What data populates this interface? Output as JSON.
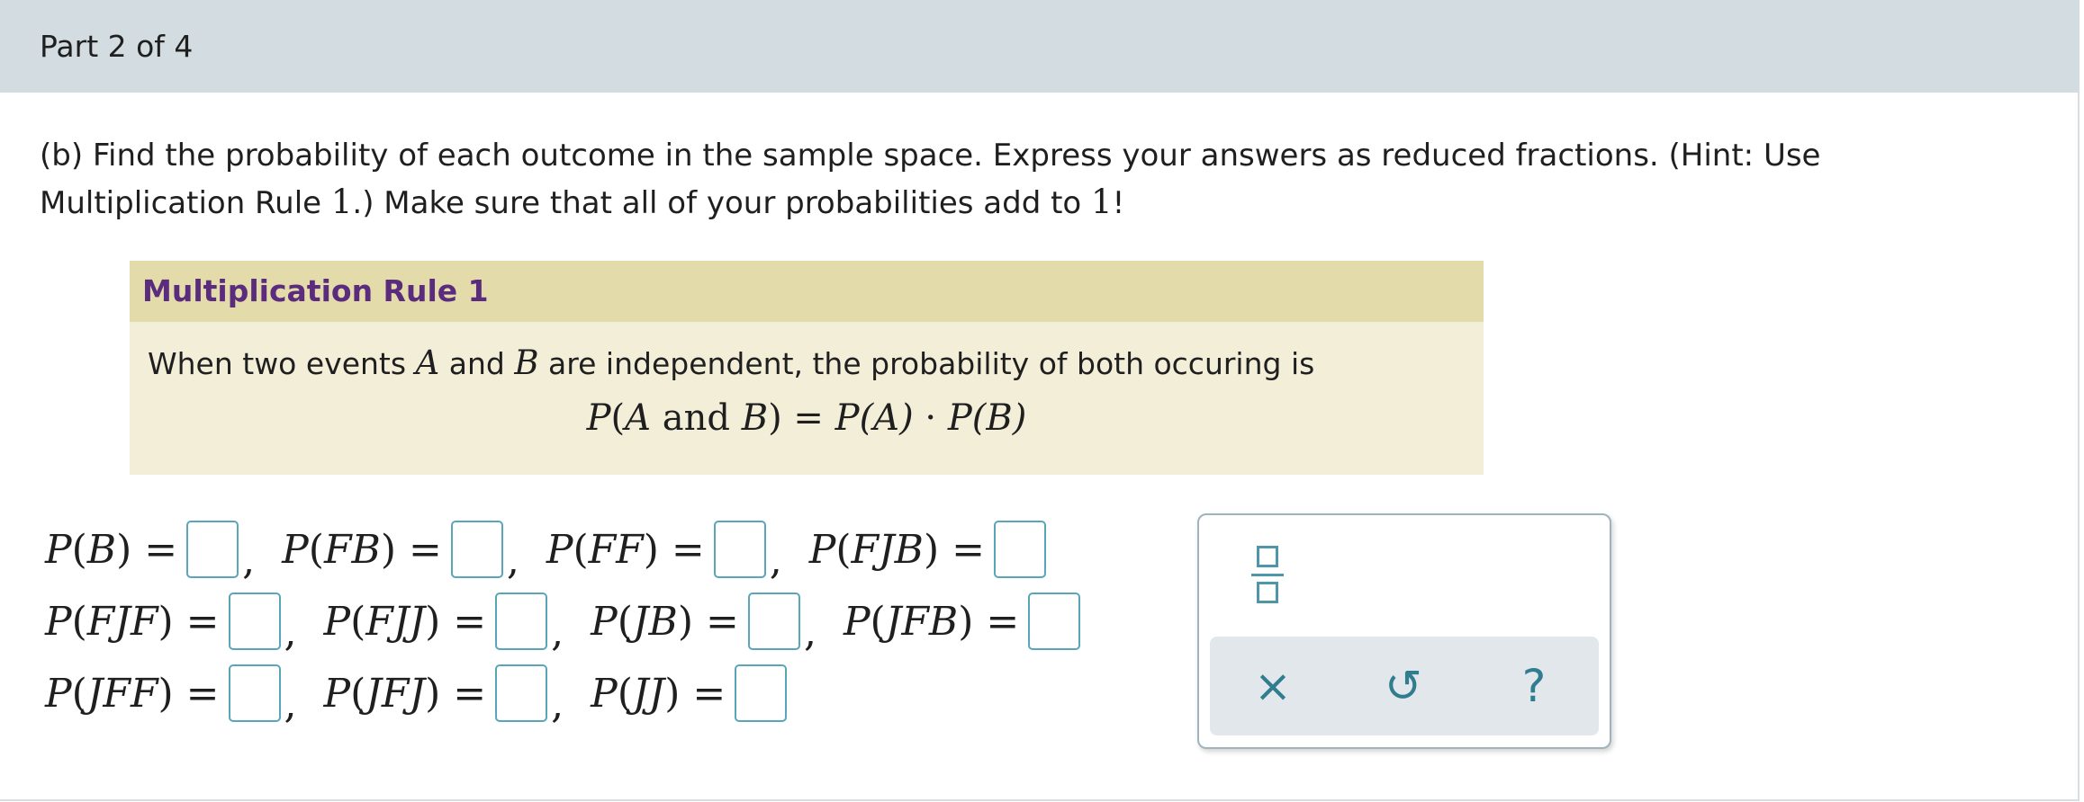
{
  "header": {
    "part_label": "Part 2 of 4"
  },
  "question": {
    "text_before_1": "(b) Find the probability of each outcome in the sample space. Express your answers as reduced fractions. (Hint: Use Multiplication Rule ",
    "one_a": "1",
    "text_middle": ".) Make sure that all of your probabilities add to ",
    "one_b": "1",
    "text_end": "!"
  },
  "rule_box": {
    "title": "Multiplication Rule 1",
    "text_before": "When two events ",
    "var_a": "A",
    "text_and": " and ",
    "var_b": "B",
    "text_after": " are independent, the probability of both occuring is",
    "formula": {
      "p1": "P",
      "open1": "(",
      "a1": "A",
      "and": " and ",
      "b1": "B",
      "close_eq": ") = ",
      "p2": "P",
      "a2": "(A)",
      "dot": " · ",
      "p3": "P",
      "b2": "(B)"
    }
  },
  "rows": [
    [
      {
        "p": "P",
        "ev": "B"
      },
      {
        "p": "P",
        "ev": "FB"
      },
      {
        "p": "P",
        "ev": "FF"
      },
      {
        "p": "P",
        "ev": "FJB"
      }
    ],
    [
      {
        "p": "P",
        "ev": "FJF"
      },
      {
        "p": "P",
        "ev": "FJJ"
      },
      {
        "p": "P",
        "ev": "JB"
      },
      {
        "p": "P",
        "ev": "JFB"
      }
    ],
    [
      {
        "p": "P",
        "ev": "JFF"
      },
      {
        "p": "P",
        "ev": "JFJ"
      },
      {
        "p": "P",
        "ev": "JJ"
      }
    ]
  ],
  "punct": {
    "open": "(",
    "close_eq": ") =",
    "comma": ","
  },
  "tools": {
    "fraction_icon": "fraction-template-icon",
    "clear": "×",
    "undo": "↺",
    "help": "?"
  },
  "colors": {
    "accent": "#4e97a8",
    "rule_title": "#5b2c7d",
    "header_bg": "#d3dce0"
  }
}
